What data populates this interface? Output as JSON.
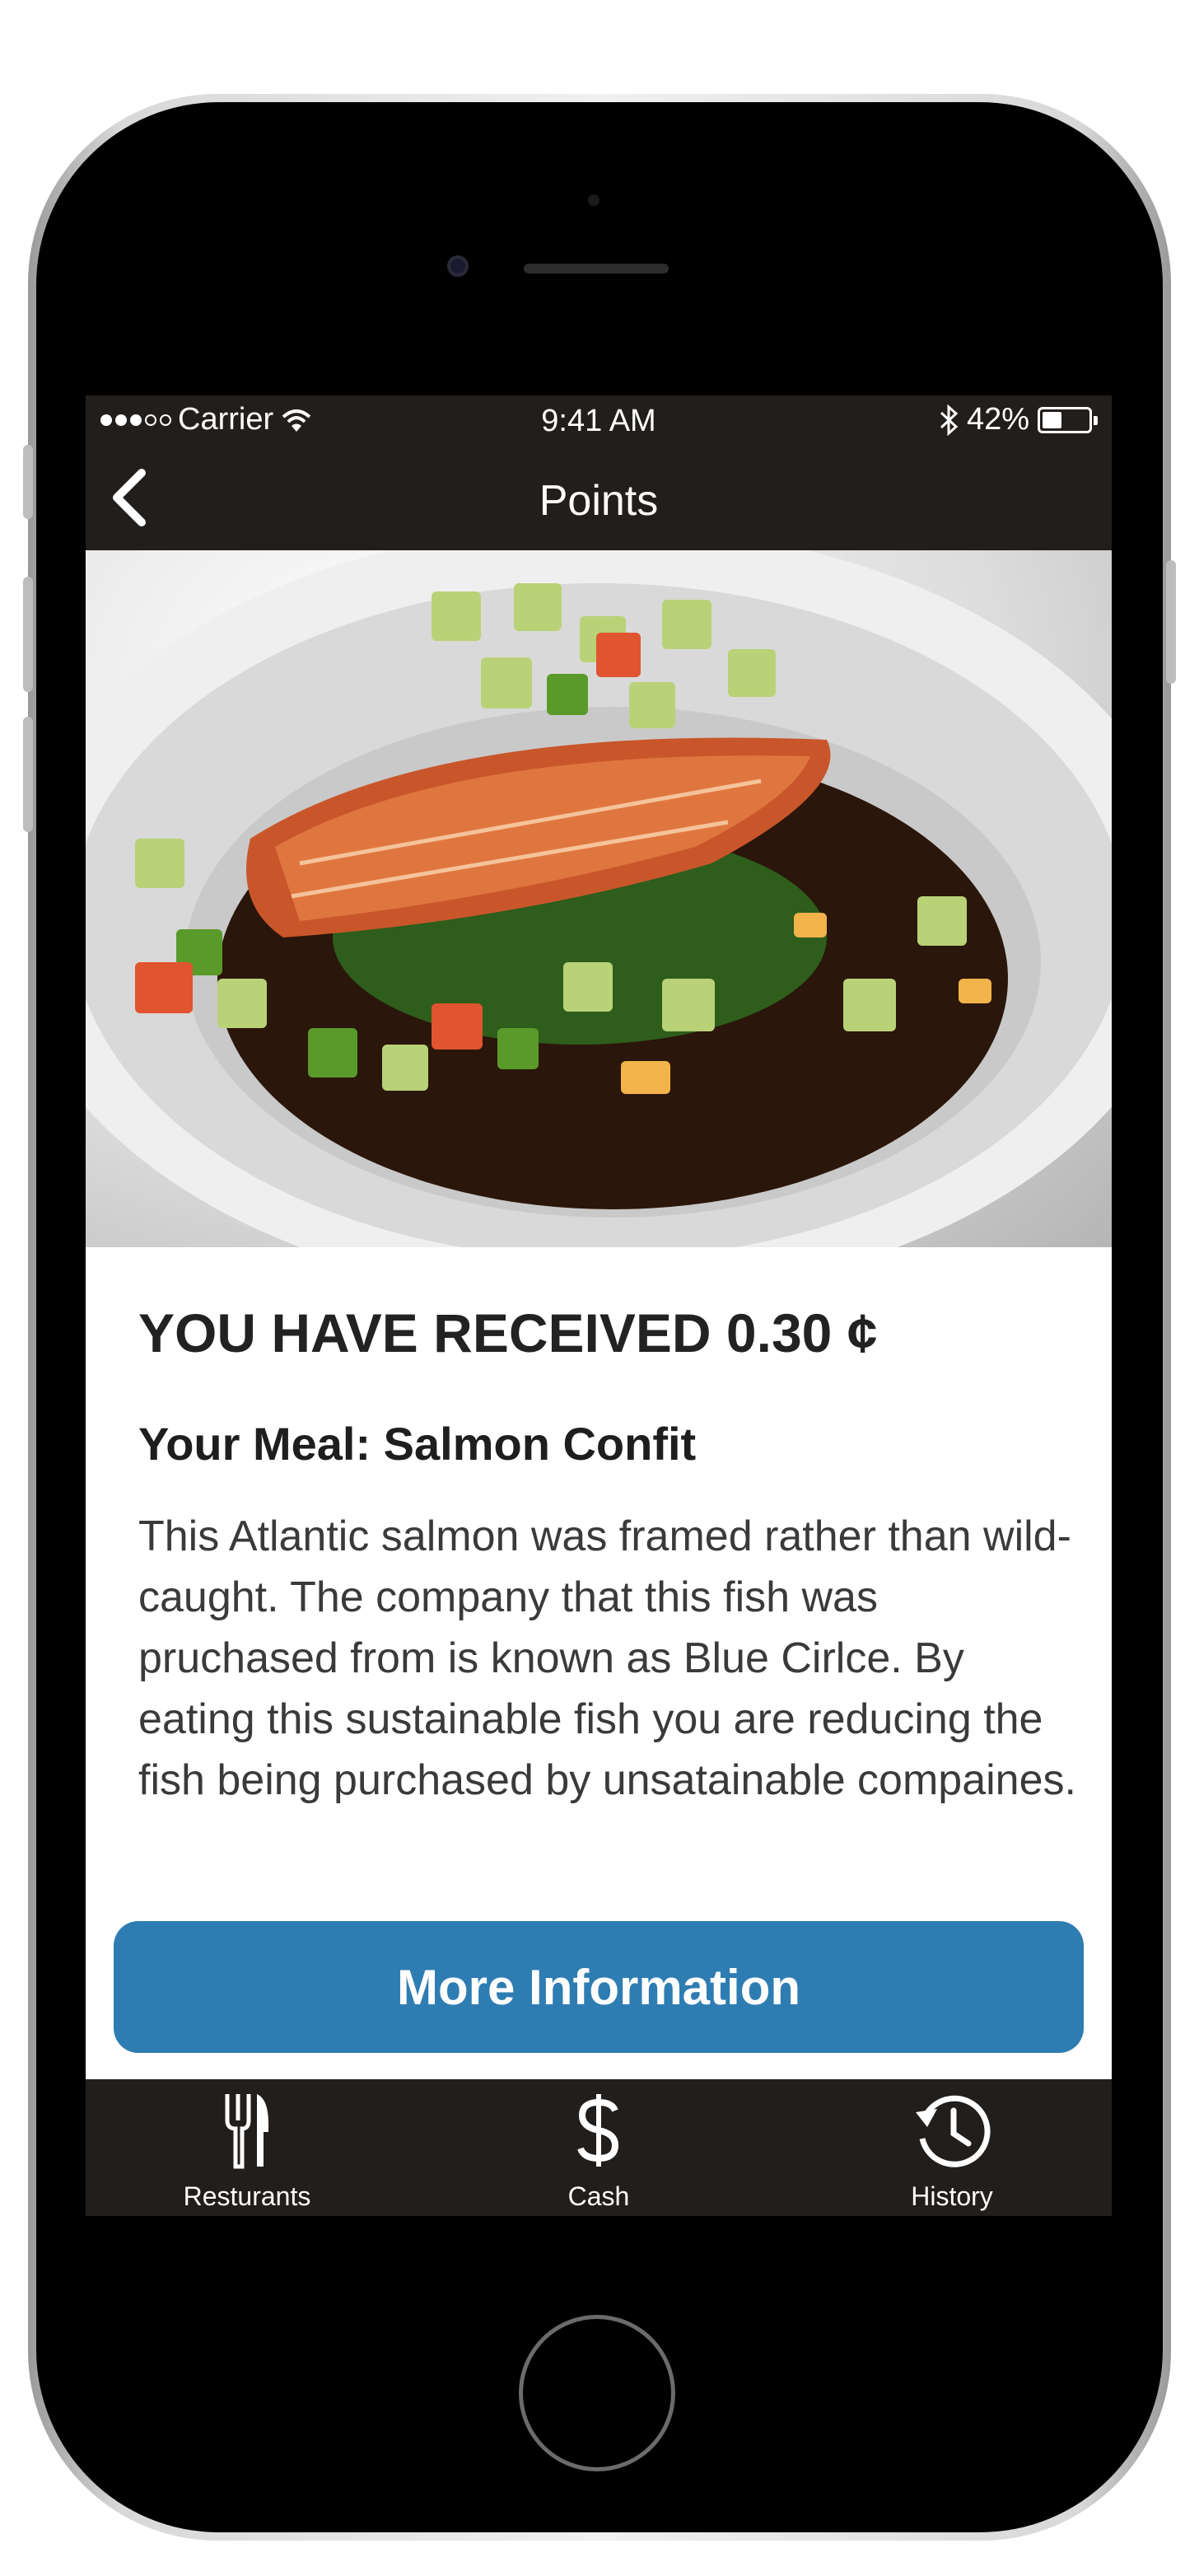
{
  "status_bar": {
    "carrier": "Carrier",
    "time": "9:41 AM",
    "battery_percent": "42%",
    "battery_level": 0.42,
    "signal_icon": "signal-dots-icon",
    "wifi_icon": "wifi-icon",
    "bluetooth_icon": "bluetooth-icon"
  },
  "nav": {
    "title": "Points",
    "back_icon": "chevron-left-icon"
  },
  "hero": {
    "description": "photo of salmon confit over greens with diced vegetables"
  },
  "content": {
    "received": "YOU HAVE RECEIVED 0.30 ¢",
    "meal_title": "Your Meal: Salmon Confit",
    "description": "This Atlantic salmon was framed rather than wild-caught. The company that this fish was pruchased from is known as Blue Cirlce. By eating this sustainable fish you are reducing the fish being purchased by unsatainable compaines.",
    "more_button": "More Information"
  },
  "tabs": [
    {
      "label": "Resturants",
      "icon": "fork-knife-icon"
    },
    {
      "label": "Cash",
      "icon": "dollar-icon"
    },
    {
      "label": "History",
      "icon": "history-clock-icon"
    }
  ],
  "colors": {
    "bar_background": "#221e1b",
    "button_blue": "#2e7db2"
  }
}
